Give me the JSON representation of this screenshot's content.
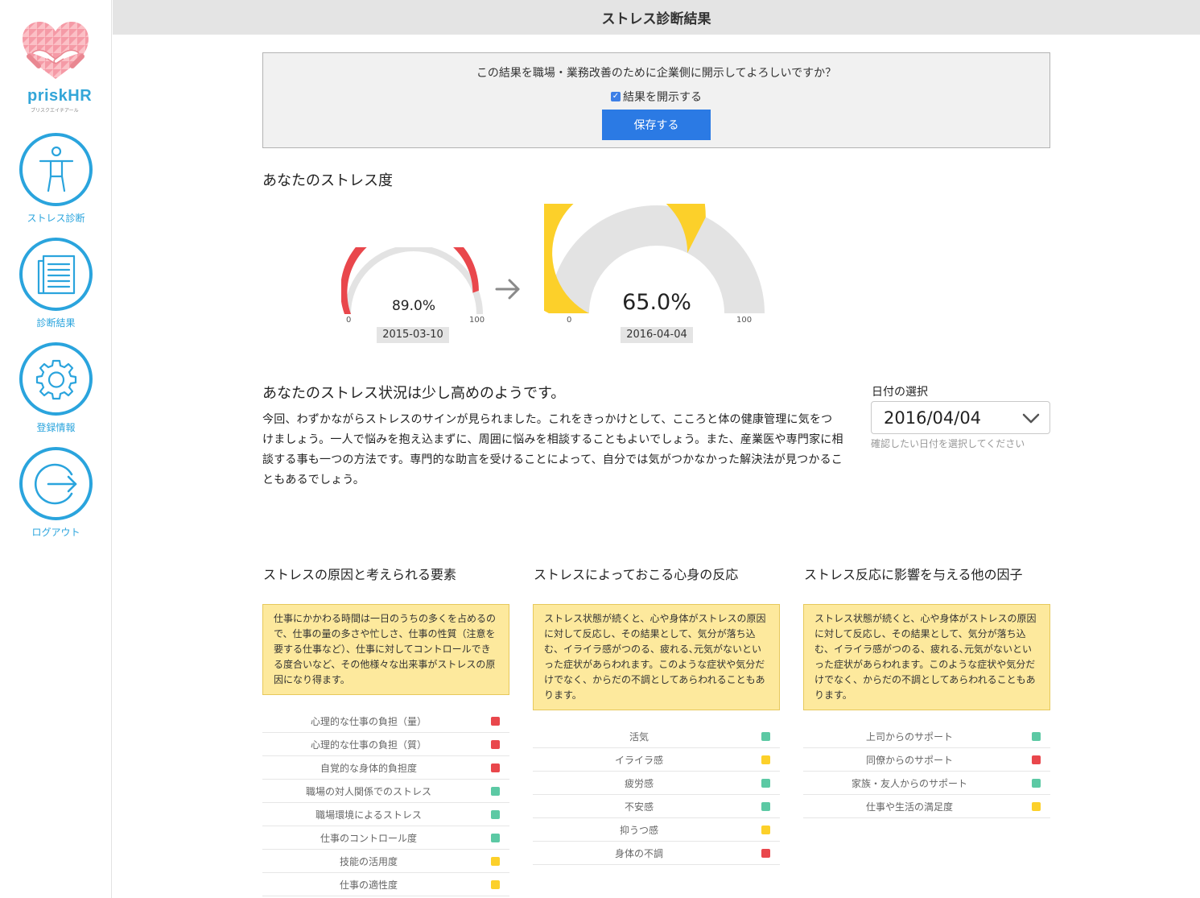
{
  "app": {
    "logo_text": "priskHR",
    "logo_sub": "プリスクエイチアール",
    "page_title": "ストレス診断結果"
  },
  "nav": [
    {
      "label": "ストレス診断",
      "icon": "person-icon"
    },
    {
      "label": "診断結果",
      "icon": "document-icon"
    },
    {
      "label": "登録情報",
      "icon": "gear-icon"
    },
    {
      "label": "ログアウト",
      "icon": "logout-icon"
    }
  ],
  "consent": {
    "question": "この結果を職場・業務改善のために企業側に開示してよろしいですか？",
    "checkbox_label": "結果を開示する",
    "checked": true,
    "save_label": "保存する"
  },
  "stress_level": {
    "title": "あなたのストレス度",
    "previous": {
      "value": 89.0,
      "label": "89.0%",
      "date": "2015-03-10",
      "min": "0",
      "max": "100",
      "color": "#e9474c"
    },
    "current": {
      "value": 65.0,
      "label": "65.0%",
      "date": "2016-04-04",
      "min": "0",
      "max": "100",
      "color": "#fcd02a"
    },
    "track_color": "#e3e3e3"
  },
  "result": {
    "heading": "あなたのストレス状況は少し高めのようです。",
    "body": "今回、わずかながらストレスのサインが見られました。これをきっかけとして、こころと体の健康管理に気をつけましょう。一人で悩みを抱え込まずに、周囲に悩みを相談することもよいでしょう。また、産業医や専門家に相談する事も一つの方法です。専門的な助言を受けることによって、自分では気がつかなかった解決法が見つかることもあるでしょう。"
  },
  "date_select": {
    "label": "日付の選択",
    "value": "2016/04/04",
    "help": "確認したい日付を選択してください"
  },
  "colors": {
    "red": "#e9474c",
    "green": "#5cc9a4",
    "yellow": "#fcd02a"
  },
  "columns": [
    {
      "title": "ストレスの原因と考えられる要素",
      "note": "仕事にかかわる時間は一日のうちの多くを占めるので、仕事の量の多さや忙しさ、仕事の性質（注意を要する仕事など）、仕事に対してコントロールできる度合いなど、その他様々な出来事がストレスの原因になり得ます。",
      "factors": [
        {
          "name": "心理的な仕事の負担（量）",
          "status": "red"
        },
        {
          "name": "心理的な仕事の負担（質）",
          "status": "red"
        },
        {
          "name": "自覚的な身体的負担度",
          "status": "red"
        },
        {
          "name": "職場の対人関係でのストレス",
          "status": "green"
        },
        {
          "name": "職場環境によるストレス",
          "status": "green"
        },
        {
          "name": "仕事のコントロール度",
          "status": "green"
        },
        {
          "name": "技能の活用度",
          "status": "yellow"
        },
        {
          "name": "仕事の適性度",
          "status": "yellow"
        }
      ]
    },
    {
      "title": "ストレスによっておこる心身の反応",
      "note": "ストレス状態が続くと、心や身体がストレスの原因に対して反応し、その結果として、気分が落ち込む、イライラ感がつのる、疲れる､元気がないといった症状があらわれます。このような症状や気分だけでなく、からだの不調としてあらわれることもあります。",
      "factors": [
        {
          "name": "活気",
          "status": "green"
        },
        {
          "name": "イライラ感",
          "status": "yellow"
        },
        {
          "name": "疲労感",
          "status": "green"
        },
        {
          "name": "不安感",
          "status": "green"
        },
        {
          "name": "抑うつ感",
          "status": "yellow"
        },
        {
          "name": "身体の不調",
          "status": "red"
        }
      ]
    },
    {
      "title": "ストレス反応に影響を与える他の因子",
      "note": "ストレス状態が続くと、心や身体がストレスの原因に対して反応し、その結果として、気分が落ち込む、イライラ感がつのる、疲れる､元気がないといった症状があらわれます。このような症状や気分だけでなく、からだの不調としてあらわれることもあります。",
      "factors": [
        {
          "name": "上司からのサポート",
          "status": "green"
        },
        {
          "name": "同僚からのサポート",
          "status": "red"
        },
        {
          "name": "家族・友人からのサポート",
          "status": "green"
        },
        {
          "name": "仕事や生活の満足度",
          "status": "yellow"
        }
      ]
    }
  ]
}
